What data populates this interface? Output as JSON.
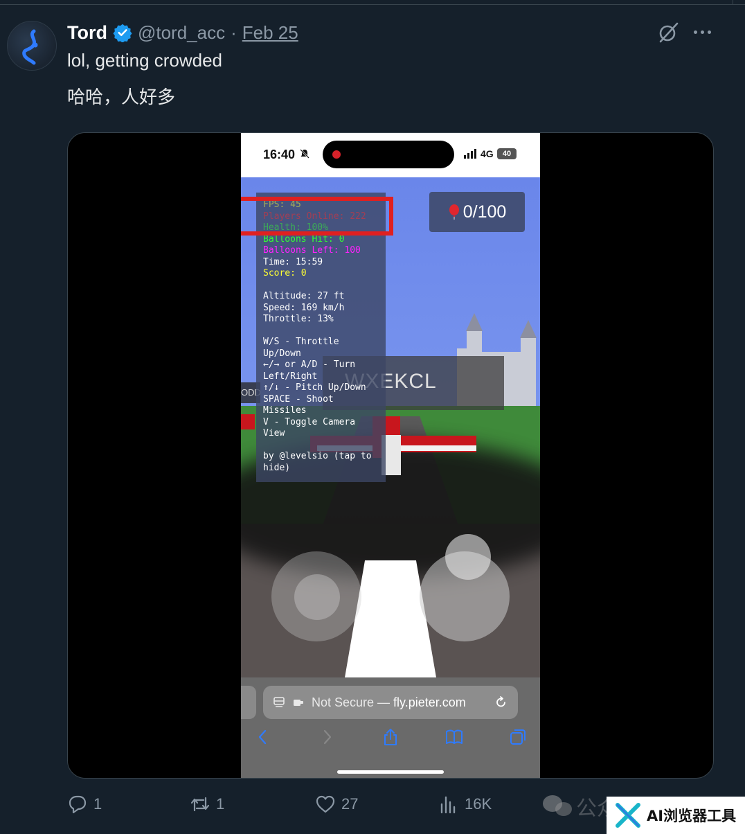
{
  "tweet": {
    "author_name": "Tord",
    "handle": "@tord_acc",
    "separator": "·",
    "date": "Feb 25",
    "text_en": "lol, getting crowded",
    "text_zh": "哈哈，人好多"
  },
  "video": {
    "status_bar": {
      "time": "16:40",
      "network": "4G",
      "battery": "40"
    },
    "hud": {
      "fps": "FPS: 45",
      "players_online": "Players Online: 222",
      "health": "Health: 100%",
      "balloons_hit": "Balloons Hit: 0",
      "balloons_left": "Balloons Left: 100",
      "time": "Time: 15:59",
      "score": "Score: 0",
      "altitude": "Altitude: 27 ft",
      "speed": "Speed: 169 km/h",
      "throttle": "Throttle: 13%",
      "control_throttle": "W/S - Throttle\nUp/Down",
      "control_turn": "←/→ or A/D - Turn\nLeft/Right",
      "control_pitch": "↑/↓ - Pitch Up/Down",
      "control_shoot": "SPACE - Shoot\nMissiles",
      "control_camera": "V - Toggle Camera\nView",
      "credit": "by @levelsio (tap to\nhide)"
    },
    "balloon_counter": "0/100",
    "player_nametag": "WXEKCL",
    "left_tag": "ODD",
    "url_bar": {
      "prefix": "Not Secure — ",
      "host": "fly.pieter.com"
    }
  },
  "actions": {
    "replies": "1",
    "reposts": "1",
    "likes": "27",
    "views": "16K"
  },
  "watermark": {
    "faded": "公众号",
    "label": "AI浏览器工具"
  },
  "colors": {
    "background": "#15202b",
    "secondary_text": "#8b98a5",
    "verified_badge": "#1d9bf0",
    "highlight": "#e02020"
  }
}
